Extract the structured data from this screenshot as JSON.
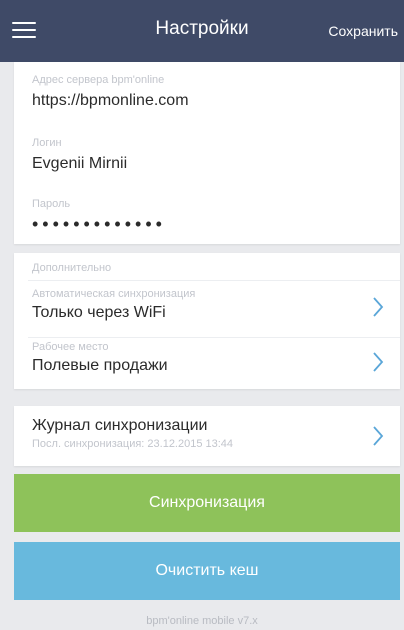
{
  "header": {
    "title": "Настройки",
    "save_label": "Сохранить",
    "menu_icon": "hamburger-menu-icon",
    "background_color": "#3f4a67"
  },
  "account": {
    "server": {
      "label": "Адрес сервера bpm'online",
      "value": "https://bpmonline.com"
    },
    "login": {
      "label": "Логин",
      "value": "Evgenii Mirnii"
    },
    "password": {
      "label": "Пароль",
      "value": "•••••••••••••"
    }
  },
  "extra": {
    "section_label": "Дополнительно",
    "auto_sync": {
      "label": "Автоматическая синхронизация",
      "value": "Только через WiFi",
      "icon": "chevron-right-icon"
    },
    "workplace": {
      "label": "Рабочее место",
      "value": "Полевые продажи",
      "icon": "chevron-right-icon"
    }
  },
  "journal": {
    "title": "Журнал синхронизации",
    "subtitle": "Посл. синхронизация: 23.12.2015 13:44",
    "icon": "chevron-right-icon"
  },
  "buttons": {
    "sync_label": "Синхронизация",
    "sync_color": "#8ec25a",
    "clear_cache_label": "Очистить кеш",
    "clear_cache_color": "#68b9dd"
  },
  "footer": {
    "version": "bpm'online mobile v7.x"
  }
}
